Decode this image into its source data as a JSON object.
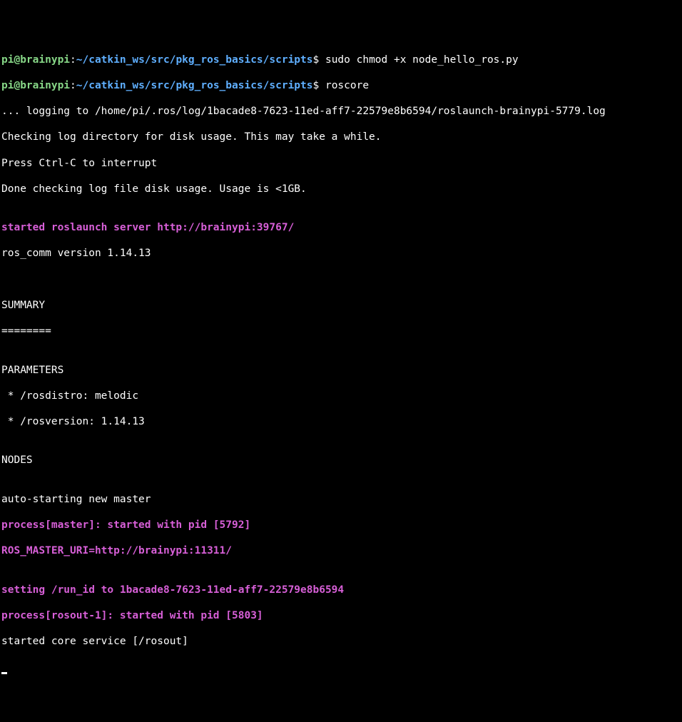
{
  "prompt1": {
    "userhost": "pi@brainypi",
    "colon": ":",
    "path": "~/catkin_ws/src/pkg_ros_basics/scripts",
    "dollar": "$ ",
    "cmd": "sudo chmod +x node_hello_ros.py"
  },
  "prompt2": {
    "userhost": "pi@brainypi",
    "colon": ":",
    "path": "~/catkin_ws/src/pkg_ros_basics/scripts",
    "dollar": "$ ",
    "cmd": "roscore"
  },
  "out": {
    "logging": "... logging to /home/pi/.ros/log/1bacade8-7623-11ed-aff7-22579e8b6594/roslaunch-brainypi-5779.log",
    "checking": "Checking log directory for disk usage. This may take a while.",
    "ctrlc": "Press Ctrl-C to interrupt",
    "done": "Done checking log file disk usage. Usage is <1GB.",
    "blank": "",
    "server": "started roslaunch server http://brainypi:39767/",
    "roscomm": "ros_comm version 1.14.13",
    "summary": "SUMMARY",
    "equals": "========",
    "parameters": "PARAMETERS",
    "rosdistro": " * /rosdistro: melodic",
    "rosversion": " * /rosversion: 1.14.13",
    "nodes": "NODES",
    "autostart": "auto-starting new master",
    "procmaster": "process[master]: started with pid [5792]",
    "masteruri": "ROS_MASTER_URI=http://brainypi:11311/",
    "runid": "setting /run_id to 1bacade8-7623-11ed-aff7-22579e8b6594",
    "procrosout": "process[rosout-1]: started with pid [5803]",
    "coreservice": "started core service [/rosout]"
  }
}
